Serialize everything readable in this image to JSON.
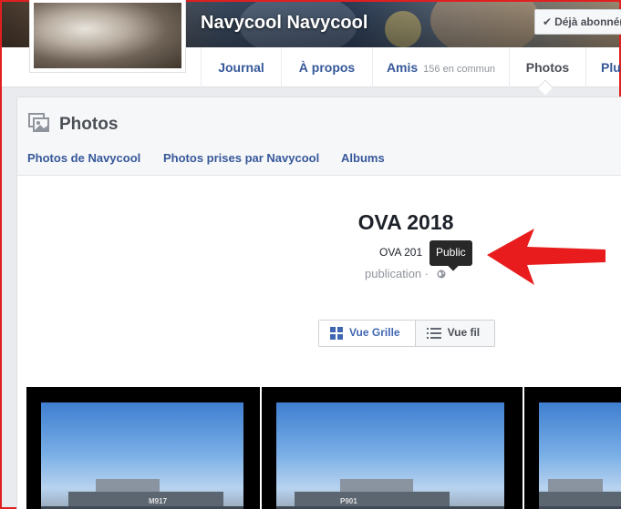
{
  "profile": {
    "name": "Navycool Navycool",
    "follow_label": "Déjà abonné(e)"
  },
  "nav": {
    "items": [
      {
        "label": "Journal"
      },
      {
        "label": "À propos"
      },
      {
        "label": "Amis",
        "mutual": "156 en commun"
      },
      {
        "label": "Photos"
      },
      {
        "label": "Plus"
      }
    ],
    "active": "Photos"
  },
  "photos_section": {
    "title": "Photos",
    "subtabs": [
      "Photos de Navycool",
      "Photos prises par Navycool",
      "Albums"
    ]
  },
  "album": {
    "title": "OVA 2018",
    "subtitle": "OVA 201",
    "meta": "publication ·",
    "privacy_tooltip": "Public"
  },
  "view_toggle": {
    "grid_label": "Vue Grille",
    "list_label": "Vue fil"
  },
  "photos": [
    {
      "hull_number": "M917"
    },
    {
      "hull_number": "P901"
    },
    {
      "hull_number": ""
    }
  ],
  "colors": {
    "link": "#365899",
    "annotation_red": "#e02020",
    "tooltip_bg": "#282828",
    "grid_icon": "#4267b2"
  },
  "icons": [
    "check-icon",
    "photos-icon",
    "globe-icon",
    "grid-icon",
    "list-icon",
    "red-arrow"
  ]
}
